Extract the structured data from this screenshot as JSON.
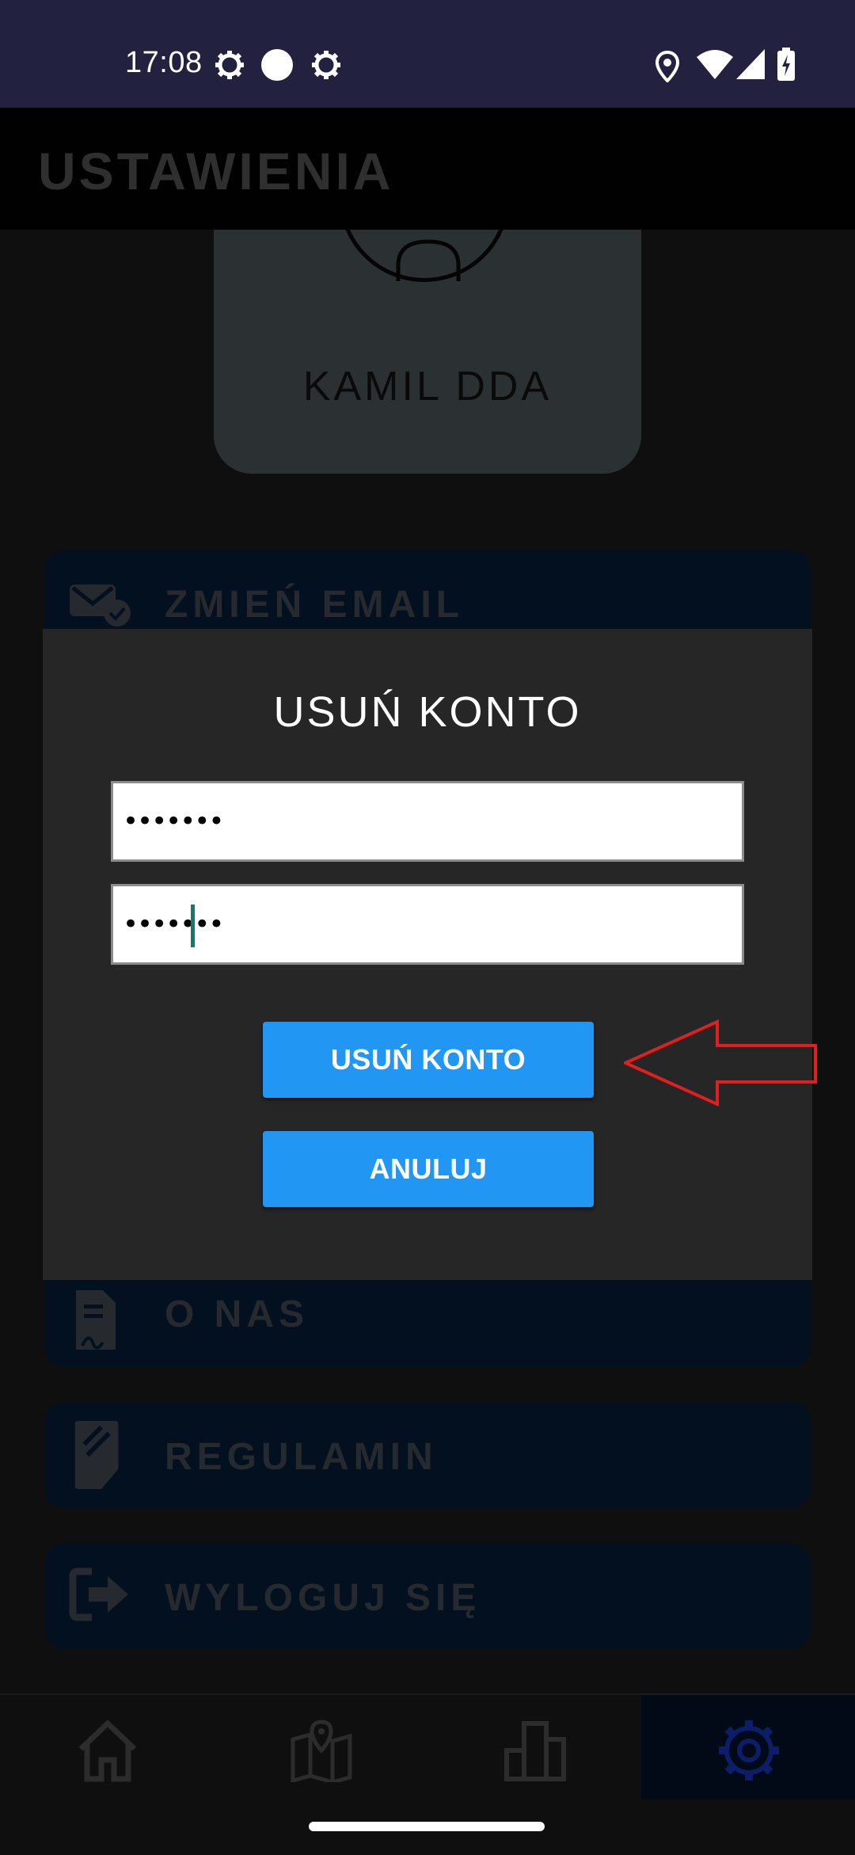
{
  "status_bar": {
    "time": "17:08",
    "left_icons": [
      "gear-icon",
      "circle-icon",
      "gear-icon"
    ],
    "right_icons": [
      "location-icon",
      "wifi-icon",
      "signal-icon",
      "battery-charging-icon"
    ]
  },
  "app_bar": {
    "title": "USTAWIENIA"
  },
  "profile": {
    "name": "KAMIL DDA"
  },
  "menu": {
    "items": [
      {
        "label": "ZMIEŃ EMAIL",
        "icon": "email-check-icon"
      },
      {
        "label": "O NAS",
        "icon": "document-signature-icon"
      },
      {
        "label": "REGULAMIN",
        "icon": "note-edit-icon"
      },
      {
        "label": "WYLOGUJ SIĘ",
        "icon": "logout-icon"
      }
    ]
  },
  "dialog": {
    "title": "USUŃ KONTO",
    "password_1": "•••••••",
    "password_2": "•••••••",
    "confirm_label": "USUŃ KONTO",
    "cancel_label": "ANULUJ"
  },
  "bottom_nav": {
    "items": [
      {
        "icon": "home-icon",
        "active": false
      },
      {
        "icon": "map-icon",
        "active": false
      },
      {
        "icon": "bar-chart-icon",
        "active": false
      },
      {
        "icon": "settings-icon",
        "active": true
      }
    ]
  },
  "colors": {
    "accent": "#2196f3",
    "status_bar": "#222240",
    "dialog": "#262626",
    "annotation_arrow": "#e02020"
  }
}
